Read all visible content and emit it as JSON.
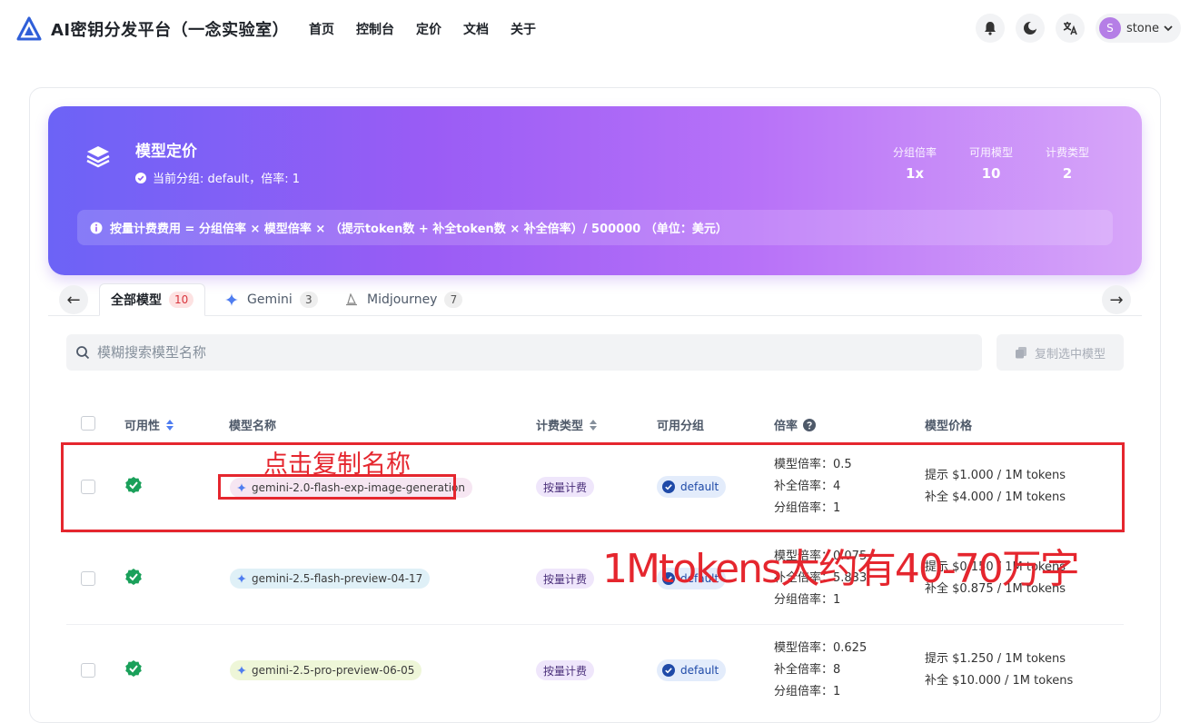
{
  "brand": {
    "title": "AI密钥分发平台（一念实验室）"
  },
  "nav": {
    "links": [
      "首页",
      "控制台",
      "定价",
      "文档",
      "关于"
    ]
  },
  "user": {
    "initial": "S",
    "name": "stone"
  },
  "hero": {
    "title": "模型定价",
    "subtitle": "当前分组: default，倍率: 1",
    "stats": [
      {
        "label": "分组倍率",
        "value": "1x"
      },
      {
        "label": "可用模型",
        "value": "10"
      },
      {
        "label": "计费类型",
        "value": "2"
      }
    ],
    "formula": "按量计费费用 = 分组倍率 × 模型倍率 × （提示token数 + 补全token数 × 补全倍率）/ 500000 （单位：美元）"
  },
  "tabs": [
    {
      "label": "全部模型",
      "count": "10",
      "active": true
    },
    {
      "label": "Gemini",
      "count": "3",
      "active": false
    },
    {
      "label": "Midjourney",
      "count": "7",
      "active": false
    }
  ],
  "nav_arrows": {
    "prev": "←",
    "next": "→"
  },
  "search": {
    "placeholder": "模糊搜索模型名称",
    "value": ""
  },
  "copy_button": {
    "label": "复制选中模型"
  },
  "table": {
    "headers": {
      "availability": "可用性",
      "model_name": "模型名称",
      "billing_type": "计费类型",
      "groups": "可用分组",
      "ratio": "倍率",
      "price": "模型价格"
    },
    "rows": [
      {
        "model": "gemini-2.0-flash-exp-image-generation",
        "billing": "按量计费",
        "group": "default",
        "ratios": [
          "模型倍率：0.5",
          "补全倍率：4",
          "分组倍率：1"
        ],
        "prices": [
          "提示 $1.000 / 1M tokens",
          "补全 $4.000 / 1M tokens"
        ]
      },
      {
        "model": "gemini-2.5-flash-preview-04-17",
        "billing": "按量计费",
        "group": "default",
        "ratios": [
          "模型倍率：0.075",
          "补全倍率：5.833",
          "分组倍率：1"
        ],
        "prices": [
          "提示 $0.150 / 1M tokens",
          "补全 $0.875 / 1M tokens"
        ]
      },
      {
        "model": "gemini-2.5-pro-preview-06-05",
        "billing": "按量计费",
        "group": "default",
        "ratios": [
          "模型倍率：0.625",
          "补全倍率：8",
          "分组倍率：1"
        ],
        "prices": [
          "提示 $1.250 / 1M tokens",
          "补全 $10.000 / 1M tokens"
        ]
      }
    ]
  },
  "annotations": {
    "click_copy": "点击复制名称",
    "token_note": "1Mtokens大约有40-70万字"
  },
  "colors": {
    "accent": "#7b5cf6",
    "annotation_red": "#e5262e",
    "success": "#1aa05a"
  }
}
